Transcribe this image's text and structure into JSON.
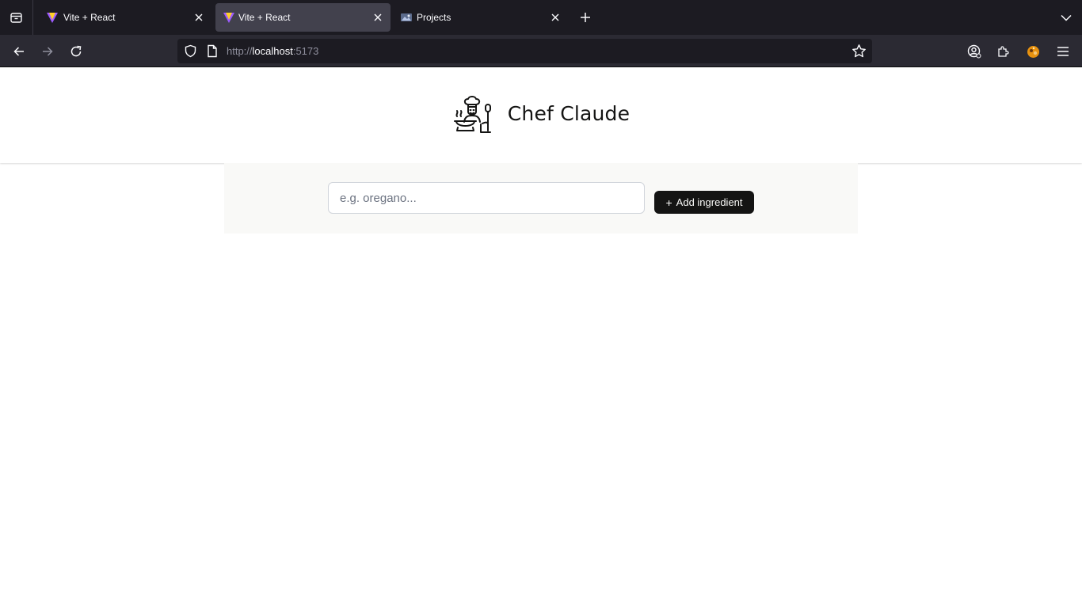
{
  "browser": {
    "tabs": [
      {
        "title": "Vite + React",
        "favicon": "vite-icon",
        "active": false
      },
      {
        "title": "Vite + React",
        "favicon": "vite-icon",
        "active": true
      },
      {
        "title": "Projects",
        "favicon": "projects-icon",
        "active": false
      }
    ],
    "url": {
      "scheme": "http://",
      "host": "localhost",
      "port": ":5173"
    }
  },
  "header": {
    "title": "Chef Claude",
    "logo_icon": "chef-icon"
  },
  "form": {
    "input_placeholder": "e.g. oregano...",
    "input_value": "",
    "button_plus": "+",
    "button_label": "Add ingredient"
  },
  "colors": {
    "tabstrip_bg": "#1c1b22",
    "toolbar_bg": "#2b2a33",
    "button_bg": "#141413",
    "form_bg": "#f9f9f7"
  }
}
